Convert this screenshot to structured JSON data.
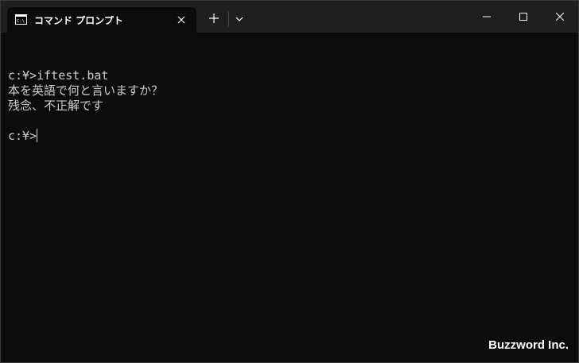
{
  "tab": {
    "title": "コマンド プロンプト",
    "icon": "terminal-icon"
  },
  "titlebar": {
    "new_tab_icon": "plus-icon",
    "dropdown_icon": "chevron-down-icon",
    "window_buttons": [
      "minimize-icon",
      "maximize-icon",
      "close-icon"
    ]
  },
  "terminal": {
    "lines": [
      "",
      "c:¥>iftest.bat",
      "本を英語で何と言いますか？",
      "残念、不正解です",
      "",
      "c:¥>"
    ]
  },
  "watermark": "Buzzword Inc.",
  "colors": {
    "background": "#0c0c0c",
    "titlebar": "#1f1f1f",
    "text": "#cccccc"
  }
}
